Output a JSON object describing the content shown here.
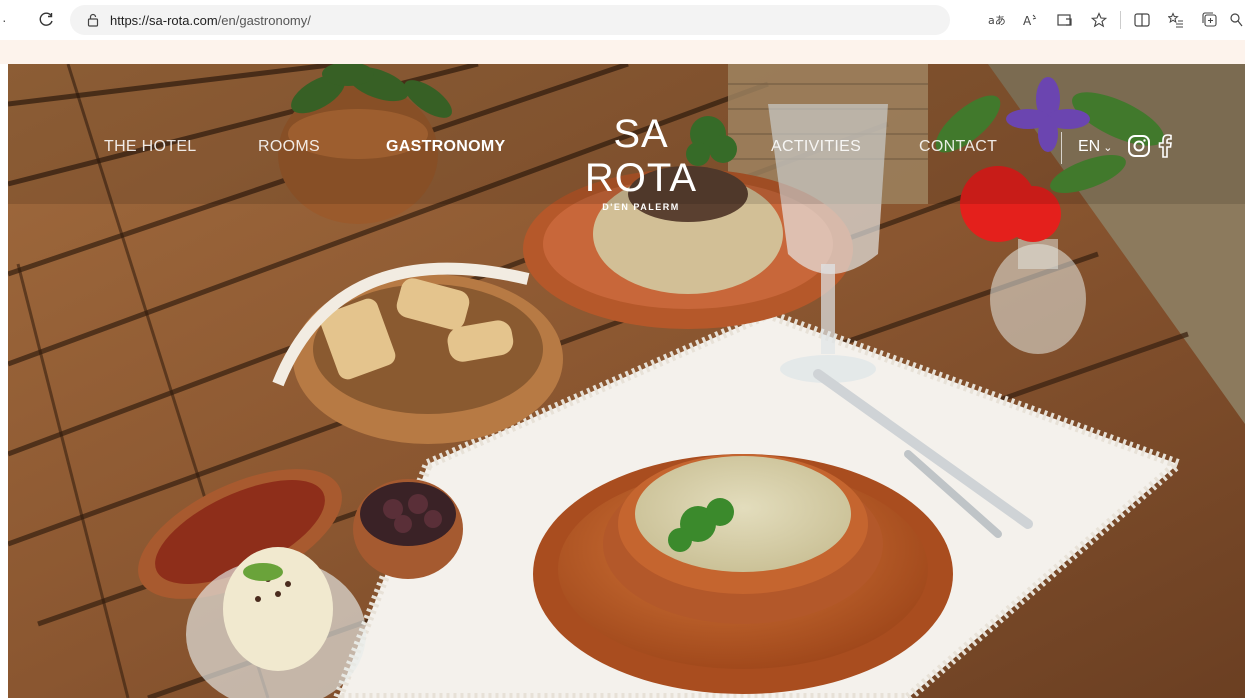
{
  "browser": {
    "url_host": "https://sa-rota.com",
    "url_path": "/en/gastronomy/"
  },
  "nav": {
    "items": [
      {
        "label": "THE HOTEL"
      },
      {
        "label": "ROOMS"
      },
      {
        "label": "GASTRONOMY",
        "active": true
      },
      {
        "label": "ACTIVITIES"
      },
      {
        "label": "CONTACT"
      }
    ],
    "logo_main": "SA ROTA",
    "logo_sub": "D'EN PALERM",
    "language": "EN",
    "icons": [
      "instagram-icon",
      "facebook-icon"
    ]
  },
  "colors": {
    "strip": "#fdf3ec",
    "table_wood": "#8a5a33",
    "terracotta": "#c4622a",
    "cloth": "#f4f1ec"
  }
}
